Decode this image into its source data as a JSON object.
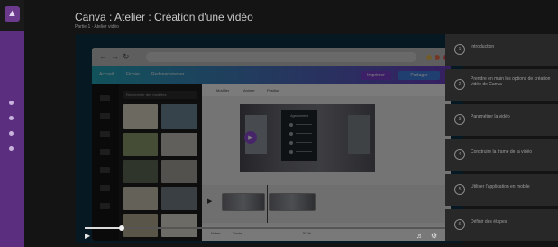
{
  "course": {
    "title": "Canva : Atelier : Création d'une vidéo",
    "breadcrumb": "Partie 1 · Atelier vidéo"
  },
  "video": {
    "progress": 0.1,
    "colors": {
      "accent": "#8e4bd3",
      "brand_teal": "#23a5b7",
      "rail_purple": "#5c2e80"
    },
    "browser_tabs": [
      "Accueil",
      "Fichier",
      "Redimensionner"
    ],
    "toolbar_buttons": [
      "Imprimer",
      "Partager"
    ],
    "search_placeholder": "Rechercher des modèles",
    "editor_tools": [
      "Modifier",
      "Animer",
      "Position"
    ],
    "slide_title": "Agencement",
    "status_bar": {
      "notes": "Notes",
      "duration": "Durée",
      "zoom": "52 %"
    },
    "icons": [
      "play-icon",
      "volume-icon",
      "settings-icon",
      "fullscreen-icon"
    ]
  },
  "lessons": [
    {
      "num": "1",
      "label": "Introduction"
    },
    {
      "num": "2",
      "label": "Prendre en main les options de création vidéo de Canva"
    },
    {
      "num": "3",
      "label": "Paramétrer la vidéo"
    },
    {
      "num": "4",
      "label": "Construire la trame de la vidéo"
    },
    {
      "num": "5",
      "label": "Utiliser l'application en mobile"
    },
    {
      "num": "6",
      "label": "Définir des étapes"
    }
  ]
}
